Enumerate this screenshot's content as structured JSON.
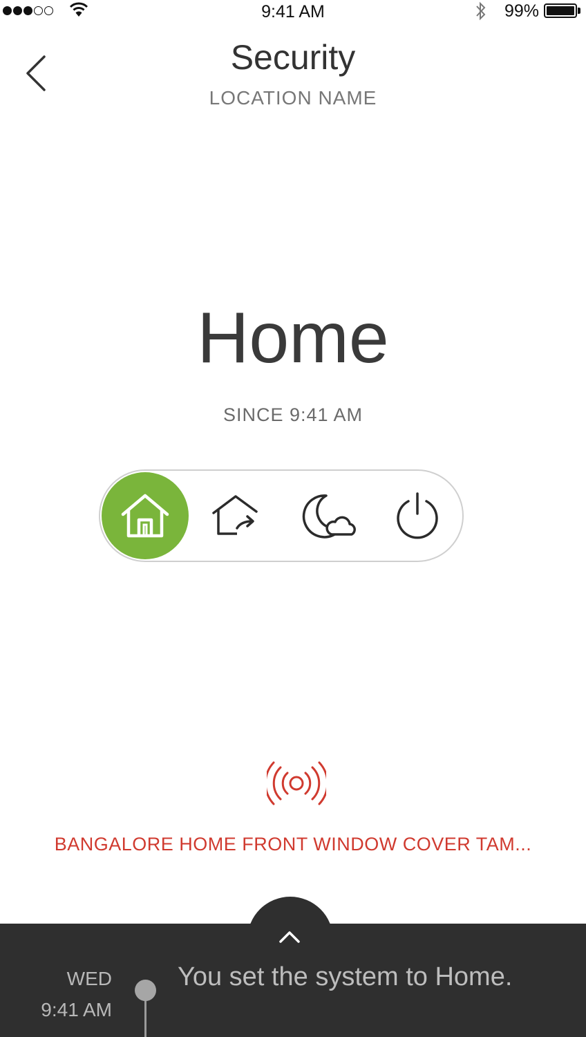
{
  "status_bar": {
    "time": "9:41 AM",
    "battery": "99%",
    "signal_bars_filled": 3,
    "signal_bars_total": 5,
    "icons": [
      "wifi-icon",
      "bluetooth-icon",
      "battery-icon"
    ]
  },
  "header": {
    "title": "Security",
    "subtitle": "LOCATION NAME",
    "back_icon": "chevron-left-icon"
  },
  "status": {
    "mode": "Home",
    "since": "SINCE 9:41 AM"
  },
  "mode_selector": {
    "active": "home",
    "accent_color": "#7ab53b",
    "modes": [
      {
        "id": "home",
        "icon": "home-icon"
      },
      {
        "id": "away",
        "icon": "away-icon"
      },
      {
        "id": "night",
        "icon": "night-icon"
      },
      {
        "id": "off",
        "icon": "power-icon"
      }
    ]
  },
  "alert": {
    "icon": "alarm-signal-icon",
    "color": "#d03a2f",
    "text": "BANGALORE HOME FRONT WINDOW COVER TAM..."
  },
  "activity": {
    "expand_icon": "chevron-up-icon",
    "day": "WED",
    "time": "9:41 AM",
    "message": "You set the system to Home."
  }
}
